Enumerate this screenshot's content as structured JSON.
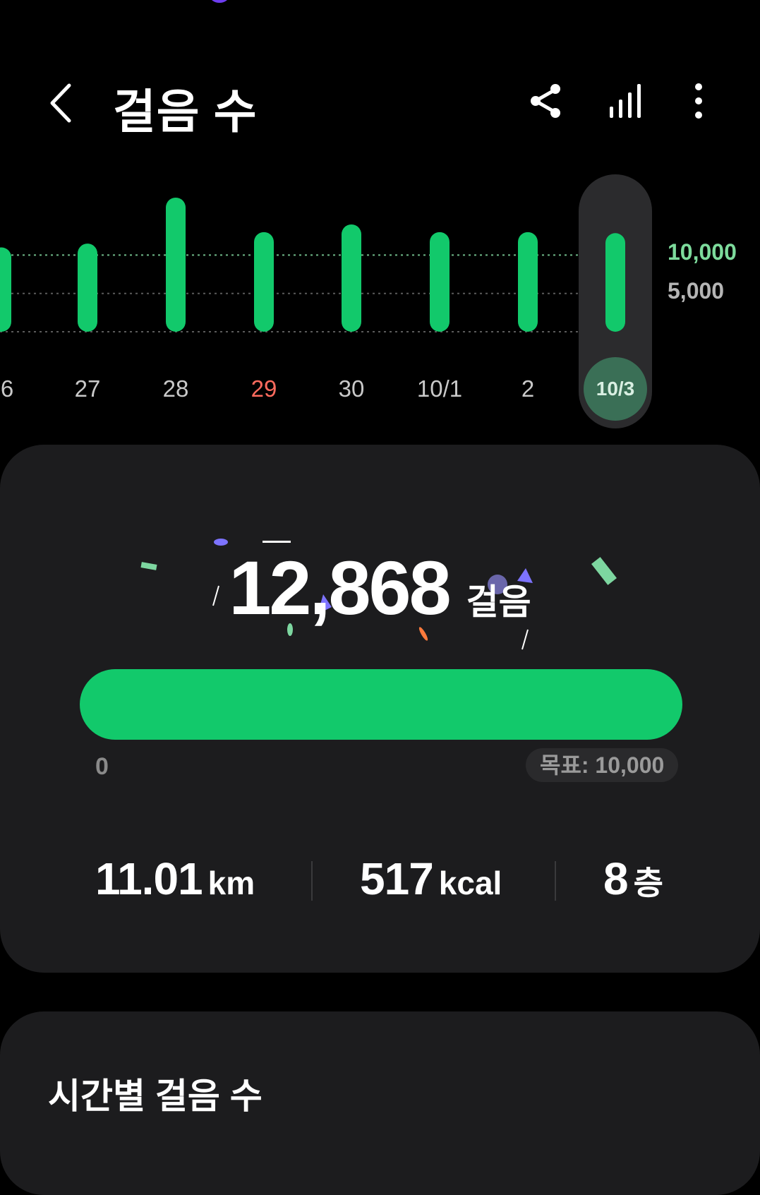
{
  "header": {
    "title": "걸음 수",
    "back_icon": "chevron-left-icon",
    "share_icon": "share-icon",
    "stats_icon": "bar-chart-icon",
    "more_icon": "more-vertical-icon"
  },
  "chart_data": {
    "type": "bar",
    "categories": [
      "6",
      "27",
      "28",
      "29",
      "30",
      "10/1",
      "2",
      "10/3"
    ],
    "values": [
      11000,
      11500,
      17500,
      13000,
      14000,
      13000,
      13000,
      12868
    ],
    "y_reference_labels": [
      "10,000",
      "5,000"
    ],
    "y_reference_values": [
      10000,
      5000
    ],
    "selected_category": "10/3",
    "highlighted_category": "29",
    "colors": {
      "bar": "#12c96b",
      "highlight_label": "#ff6b5e",
      "selected_bg": "#2b2b2d",
      "selected_badge": "#3a6f56",
      "goal_label": "#7ddb9c"
    }
  },
  "summary": {
    "steps": "12,868",
    "steps_unit": "걸음",
    "progress_fraction": 1.0,
    "progress_min": "0",
    "goal_label": "목표: 10,000",
    "distance_value": "11.01",
    "distance_unit": "km",
    "calories_value": "517",
    "calories_unit": "kcal",
    "floors_value": "8",
    "floors_unit": "층"
  },
  "hourly": {
    "title": "시간별 걸음 수"
  }
}
